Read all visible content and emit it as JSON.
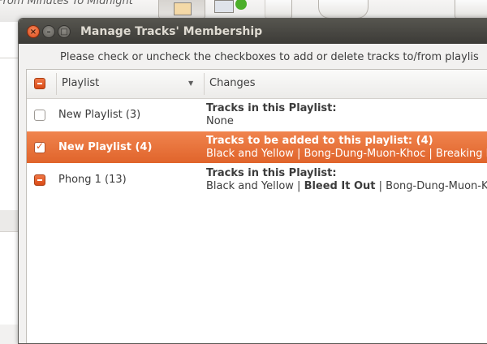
{
  "background_app": {
    "toolbar_text": "From Minutes To Midnight"
  },
  "dialog": {
    "title": "Manage Tracks' Membership",
    "instructions": "Please check or uncheck the checkboxes to add or delete tracks to/from playlis",
    "columns": {
      "playlist": "Playlist",
      "changes": "Changes"
    },
    "rows": [
      {
        "name": "New Playlist (3)",
        "state": "unchecked",
        "line1": "Tracks in this Playlist:",
        "line2_parts": [
          "None"
        ]
      },
      {
        "name": "New Playlist (4)",
        "state": "checked",
        "line1": "Tracks to be added to this playlist: (4)",
        "line2_parts": [
          "Black and Yellow | Bong-Dung-Muon-Khoc | Breaking B"
        ]
      },
      {
        "name": "Phong 1 (13)",
        "state": "mixed",
        "line1": "Tracks in this Playlist:",
        "line2_parts": [
          "Black and Yellow | ",
          "Bleed It Out",
          " | Bong-Dung-Muon-Kh"
        ]
      }
    ]
  },
  "colors": {
    "accent": "#e8703a",
    "titlebar": "#3c3b37"
  }
}
